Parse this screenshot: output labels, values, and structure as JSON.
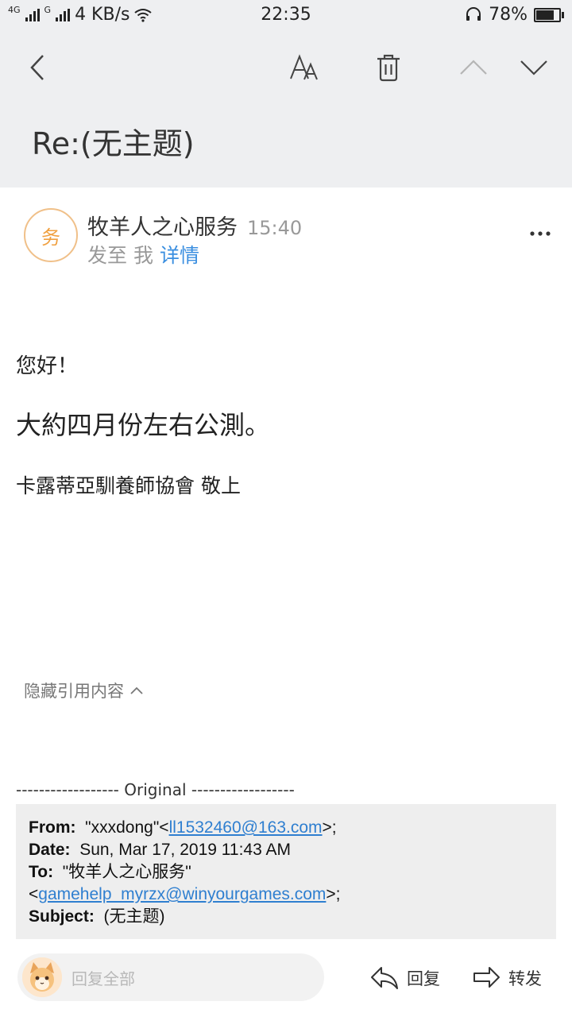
{
  "status_bar": {
    "network_1": "4G",
    "network_2": "G",
    "speed": "4 KB/s",
    "time": "22:35",
    "battery": "78%",
    "battery_level": 0.78
  },
  "header": {
    "subject": "Re:(无主题)"
  },
  "sender": {
    "avatar_char": "务",
    "name": "牧羊人之心服务",
    "time": "15:40",
    "to_prefix": "发至 我",
    "details": "详情"
  },
  "body": {
    "greeting": "您好！",
    "main": "大約四月份左右公測。",
    "signature": "卡露蒂亞馴養師協會 敬上"
  },
  "quote": {
    "toggle_label": "隐藏引用内容",
    "separator": "------------------ Original ------------------",
    "from_label": "From:",
    "from_name": "\"xxxdong\"<",
    "from_email": "ll1532460@163.com",
    "from_suffix": ">;",
    "date_label": "Date:",
    "date_value": "Sun, Mar 17, 2019 11:43 AM",
    "to_label": "To:",
    "to_name": "\"牧羊人之心服务\"",
    "to_prefix": "<",
    "to_email": "gamehelp_myrzx@winyourgames.com",
    "to_suffix": ">;",
    "subject_label": "Subject:",
    "subject_value": "(无主题)"
  },
  "bottom": {
    "reply_all_placeholder": "回复全部",
    "reply": "回复",
    "forward": "转发"
  },
  "icons": {
    "back": "chevron-left-icon",
    "font": "font-size-icon",
    "trash": "trash-icon",
    "prev": "chevron-up-icon",
    "next": "chevron-down-icon",
    "more": "more-dots-icon",
    "reply": "reply-icon",
    "forward": "forward-icon"
  }
}
